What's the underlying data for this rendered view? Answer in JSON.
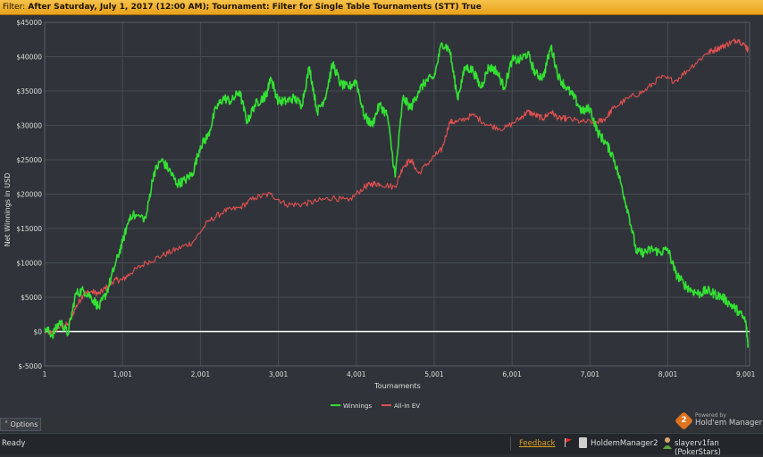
{
  "filter": {
    "label": "Filter:",
    "text": "After Saturday, July 1, 2017 (12:00 AM); Tournament: Filter for Single Table Tournaments (STT) True"
  },
  "chart_data": {
    "type": "line",
    "title": "",
    "xlabel": "Tournaments",
    "ylabel": "Net Winnings in USD",
    "xlim": [
      1,
      9050
    ],
    "ylim": [
      -5000,
      45000
    ],
    "x_ticks": [
      1,
      1001,
      2001,
      3001,
      4001,
      5001,
      6001,
      7001,
      8001,
      9001
    ],
    "x_tick_labels": [
      "1",
      "1,001",
      "2,001",
      "3,001",
      "4,001",
      "5,001",
      "6,001",
      "7,001",
      "8,001",
      "9,001"
    ],
    "y_ticks": [
      -5000,
      0,
      5000,
      10000,
      15000,
      20000,
      25000,
      30000,
      35000,
      40000,
      45000
    ],
    "y_tick_labels": [
      "$-5000",
      "$0",
      "$5000",
      "$10000",
      "$15000",
      "$20000",
      "$25000",
      "$30000",
      "$35000",
      "$40000",
      "$45000"
    ],
    "grid": true,
    "legend": "bottom-center",
    "series": [
      {
        "name": "Winnings",
        "color": "#33e033",
        "x": [
          1,
          100,
          200,
          300,
          400,
          500,
          600,
          700,
          800,
          900,
          1000,
          1100,
          1300,
          1400,
          1500,
          1600,
          1700,
          1800,
          1900,
          2000,
          2100,
          2200,
          2300,
          2400,
          2500,
          2600,
          2700,
          2800,
          2850,
          2900,
          3000,
          3100,
          3200,
          3300,
          3400,
          3500,
          3600,
          3700,
          3800,
          3900,
          4000,
          4100,
          4200,
          4300,
          4400,
          4500,
          4600,
          4700,
          4800,
          4900,
          5000,
          5100,
          5200,
          5300,
          5400,
          5500,
          5600,
          5700,
          5800,
          5900,
          6000,
          6100,
          6200,
          6300,
          6400,
          6500,
          6600,
          6700,
          6800,
          6900,
          7000,
          7100,
          7200,
          7300,
          7400,
          7500,
          7600,
          7700,
          7800,
          7900,
          8000,
          8100,
          8200,
          8300,
          8400,
          8500,
          8600,
          8700,
          8800,
          8900,
          9000,
          9030
        ],
        "y": [
          500,
          -500,
          1500,
          -300,
          5500,
          6000,
          5000,
          3500,
          5800,
          9500,
          13000,
          17000,
          16500,
          23000,
          25000,
          23500,
          21500,
          22000,
          23000,
          27000,
          28500,
          32500,
          34000,
          33500,
          35000,
          30500,
          33000,
          34000,
          34500,
          37000,
          33500,
          33500,
          34000,
          33000,
          38500,
          32000,
          34000,
          39000,
          36000,
          35500,
          36500,
          31500,
          30000,
          33000,
          31500,
          22500,
          34000,
          32500,
          35000,
          36500,
          37000,
          42000,
          41000,
          34000,
          38500,
          38000,
          35500,
          38500,
          38000,
          35500,
          39500,
          39500,
          40500,
          37500,
          37000,
          41500,
          37000,
          35500,
          34000,
          32000,
          32500,
          29000,
          27500,
          25500,
          21500,
          17000,
          11500,
          11500,
          12000,
          11500,
          12000,
          8500,
          7000,
          6000,
          5500,
          6000,
          5500,
          5000,
          4000,
          3000,
          1500,
          -2000
        ]
      },
      {
        "name": "All-In EV",
        "color": "#e05050",
        "x": [
          1,
          100,
          200,
          300,
          400,
          500,
          600,
          700,
          800,
          900,
          1000,
          1100,
          1300,
          1500,
          1700,
          1900,
          2100,
          2300,
          2500,
          2700,
          2900,
          3100,
          3300,
          3500,
          3700,
          3900,
          4100,
          4200,
          4300,
          4500,
          4600,
          4700,
          4800,
          5000,
          5100,
          5200,
          5300,
          5500,
          5700,
          5900,
          6100,
          6200,
          6300,
          6400,
          6500,
          6600,
          6700,
          6900,
          7100,
          7200,
          7300,
          7500,
          7700,
          7900,
          8100,
          8300,
          8500,
          8600,
          8700,
          8800,
          8900,
          9000,
          9030
        ],
        "y": [
          0,
          -200,
          800,
          1000,
          3500,
          5500,
          5800,
          5500,
          6500,
          7500,
          7500,
          8500,
          10000,
          11000,
          12000,
          13000,
          16000,
          17500,
          18000,
          19500,
          20000,
          18500,
          18500,
          19000,
          19500,
          19000,
          21000,
          21500,
          21500,
          21000,
          24000,
          25000,
          23000,
          25500,
          26500,
          30500,
          30500,
          31500,
          30000,
          29500,
          31000,
          32000,
          31500,
          31000,
          32000,
          31000,
          31000,
          30500,
          30500,
          31000,
          32500,
          34000,
          35000,
          37000,
          36500,
          38500,
          40500,
          41000,
          41500,
          42000,
          42500,
          41500,
          41000
        ]
      }
    ],
    "zero_line_color": "#ffffff"
  },
  "options": {
    "label": "Options"
  },
  "branding": {
    "powered_by": "Powered by",
    "name": "Hold'em Manager",
    "logo_number": "2"
  },
  "status": {
    "text": "Ready",
    "feedback": "Feedback",
    "app": "HoldemManager2",
    "user": "slayerv1fan (PokerStars)"
  }
}
